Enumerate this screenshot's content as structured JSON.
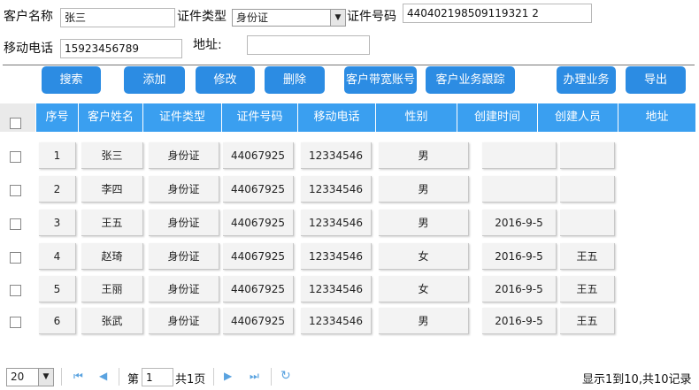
{
  "form": {
    "name_label": "客户名称",
    "name_value": "张三",
    "idtype_label": "证件类型",
    "idtype_value": "身份证",
    "idnum_label": "证件号码",
    "idnum_value": "440402198509119321 2",
    "phone_label": "移动电话",
    "phone_value": "15923456789",
    "addr_label": "地址:",
    "addr_value": ""
  },
  "toolbar": {
    "search": "搜索",
    "add": "添加",
    "edit": "修改",
    "delete": "删除",
    "broadband": "客户带宽账号",
    "tracking": "客户业务跟踪",
    "handle": "办理业务",
    "export": "导出"
  },
  "table": {
    "headers": [
      "序号",
      "客户姓名",
      "证件类型",
      "证件号码",
      "移动电话",
      "性别",
      "创建时间",
      "创建人员",
      "地址"
    ],
    "rows": [
      {
        "no": "1",
        "name": "张三",
        "idtype": "身份证",
        "idnum": "44067925",
        "phone": "12334546",
        "sex": "男",
        "created": "",
        "creator": ""
      },
      {
        "no": "2",
        "name": "李四",
        "idtype": "身份证",
        "idnum": "44067925",
        "phone": "12334546",
        "sex": "男",
        "created": "",
        "creator": ""
      },
      {
        "no": "3",
        "name": "王五",
        "idtype": "身份证",
        "idnum": "44067925",
        "phone": "12334546",
        "sex": "男",
        "created": "2016-9-5",
        "creator": ""
      },
      {
        "no": "4",
        "name": "赵琦",
        "idtype": "身份证",
        "idnum": "44067925",
        "phone": "12334546",
        "sex": "女",
        "created": "2016-9-5",
        "creator": "王五"
      },
      {
        "no": "5",
        "name": "王丽",
        "idtype": "身份证",
        "idnum": "44067925",
        "phone": "12334546",
        "sex": "女",
        "created": "2016-9-5",
        "creator": "王五"
      },
      {
        "no": "6",
        "name": "张武",
        "idtype": "身份证",
        "idnum": "44067925",
        "phone": "12334546",
        "sex": "男",
        "created": "2016-9-5",
        "creator": "王五"
      }
    ]
  },
  "pager": {
    "page_size": "20",
    "page_prefix": "第",
    "page_value": "1",
    "page_suffix": "共1页",
    "summary": "显示1到10,共10记录"
  }
}
